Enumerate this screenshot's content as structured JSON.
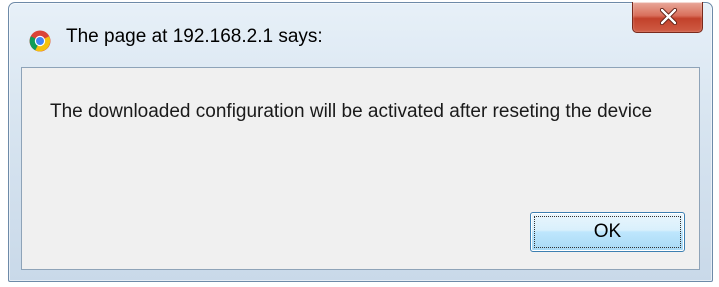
{
  "dialog": {
    "title": "The page at 192.168.2.1 says:",
    "title_icon": "chrome-icon",
    "close_icon": "close-icon",
    "message": "The downloaded configuration will be activated after reseting the device",
    "ok_label": "OK"
  },
  "colors": {
    "frame": "#d7e4f0",
    "close_button": "#c2412b",
    "client_area": "#f0f0f0",
    "ok_button_border": "#3c7fb1"
  }
}
